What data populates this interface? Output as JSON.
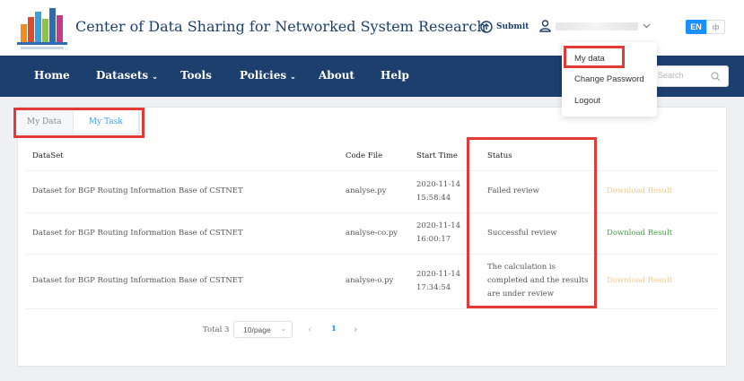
{
  "header": {
    "site_title": "Center of Data Sharing for Networked System Research",
    "submit_label": "Submit",
    "lang_active": "EN"
  },
  "nav": {
    "items": [
      {
        "label": "Home"
      },
      {
        "label": "Datasets"
      },
      {
        "label": "Tools"
      },
      {
        "label": "Policies"
      },
      {
        "label": "About"
      },
      {
        "label": "Help"
      }
    ],
    "search_placeholder": "Search"
  },
  "user_menu": {
    "items": [
      "My data",
      "Change Password",
      "Logout"
    ]
  },
  "tabs": [
    "My Data",
    "My Task"
  ],
  "table": {
    "headers": [
      "DataSet",
      "Code File",
      "Start Time",
      "Status",
      ""
    ],
    "rows": [
      {
        "dataset": "Dataset for BGP Routing Information Base of CSTNET",
        "code_file": "analyse.py",
        "start_date": "2020-11-14",
        "start_time": "15:58:44",
        "status": "Failed review",
        "action": "Download Result"
      },
      {
        "dataset": "Dataset for BGP Routing Information Base of CSTNET",
        "code_file": "analyse-co.py",
        "start_date": "2020-11-14",
        "start_time": "16:00:17",
        "status": "Successful review",
        "action": "Download Result"
      },
      {
        "dataset": "Dataset for BGP Routing Information Base of CSTNET",
        "code_file": "analyse-o.py",
        "start_date": "2020-11-14",
        "start_time": "17:34:54",
        "status": "The calculation is completed and the results are under review",
        "action": "Download Result"
      }
    ]
  },
  "pagination": {
    "total": "Total 3",
    "page_size": "10/page",
    "current_page": "1"
  },
  "colors": {
    "nav_bg": "#1d3f6e",
    "accent": "#1890ff",
    "highlight_box": "#e53935",
    "download_enabled": "#45a04a",
    "download_disabled": "#f4c98a"
  }
}
